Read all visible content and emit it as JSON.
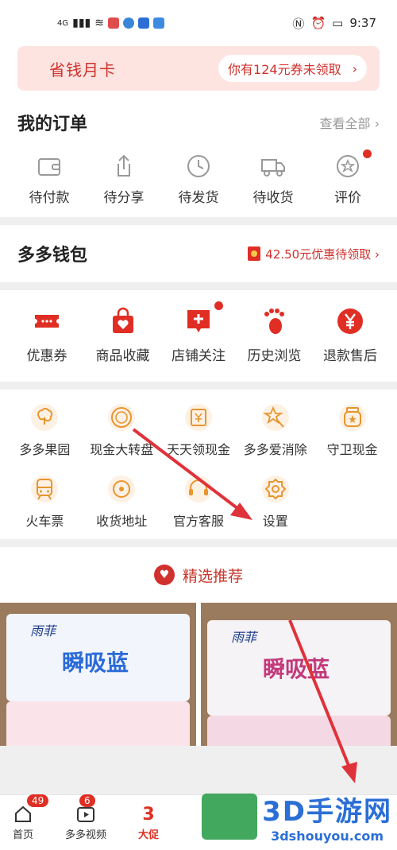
{
  "status_bar": {
    "left": "4G",
    "time": "9:37"
  },
  "money_card": {
    "title": "省钱月卡",
    "coupon_text": "你有124元券未领取",
    "chevron": "›"
  },
  "orders": {
    "title": "我的订单",
    "see_all": "查看全部 ›",
    "items": [
      {
        "label": "待付款",
        "icon": "wallet-icon"
      },
      {
        "label": "待分享",
        "icon": "share-icon"
      },
      {
        "label": "待发货",
        "icon": "clock-icon"
      },
      {
        "label": "待收货",
        "icon": "truck-icon"
      },
      {
        "label": "评价",
        "icon": "review-icon"
      }
    ]
  },
  "wallet": {
    "title": "多多钱包",
    "promo": "42.50元优惠待领取 ›"
  },
  "quick_links": [
    {
      "label": "优惠券",
      "icon": "coupon-icon"
    },
    {
      "label": "商品收藏",
      "icon": "bag-heart-icon"
    },
    {
      "label": "店铺关注",
      "icon": "store-plus-icon"
    },
    {
      "label": "历史浏览",
      "icon": "footprint-icon"
    },
    {
      "label": "退款售后",
      "icon": "yen-icon"
    }
  ],
  "tools": [
    {
      "label": "多多果园",
      "icon": "tree-icon"
    },
    {
      "label": "现金大转盘",
      "icon": "wheel-icon"
    },
    {
      "label": "天天领现金",
      "icon": "cash-icon"
    },
    {
      "label": "多多爱消除",
      "icon": "star-wand-icon"
    },
    {
      "label": "守卫现金",
      "icon": "jar-icon"
    },
    {
      "label": "火车票",
      "icon": "train-icon"
    },
    {
      "label": "收货地址",
      "icon": "location-icon"
    },
    {
      "label": "官方客服",
      "icon": "headset-icon"
    },
    {
      "label": "设置",
      "icon": "gear-icon"
    }
  ],
  "recommend": {
    "title": "精选推荐"
  },
  "products": [
    {
      "brand": "雨菲",
      "name": "瞬吸蓝"
    },
    {
      "brand": "雨菲",
      "name": "瞬吸蓝"
    }
  ],
  "bottom_nav": [
    {
      "label": "首页",
      "badge": "49"
    },
    {
      "label": "多多视频",
      "badge": "6"
    },
    {
      "label": "大促",
      "badge": "3"
    }
  ],
  "watermark": {
    "title": "3D手游网",
    "url": "3dshouyou.com"
  },
  "colors": {
    "accent": "#e02e24",
    "tool_orange": "#e8952f",
    "text": "#222222"
  }
}
